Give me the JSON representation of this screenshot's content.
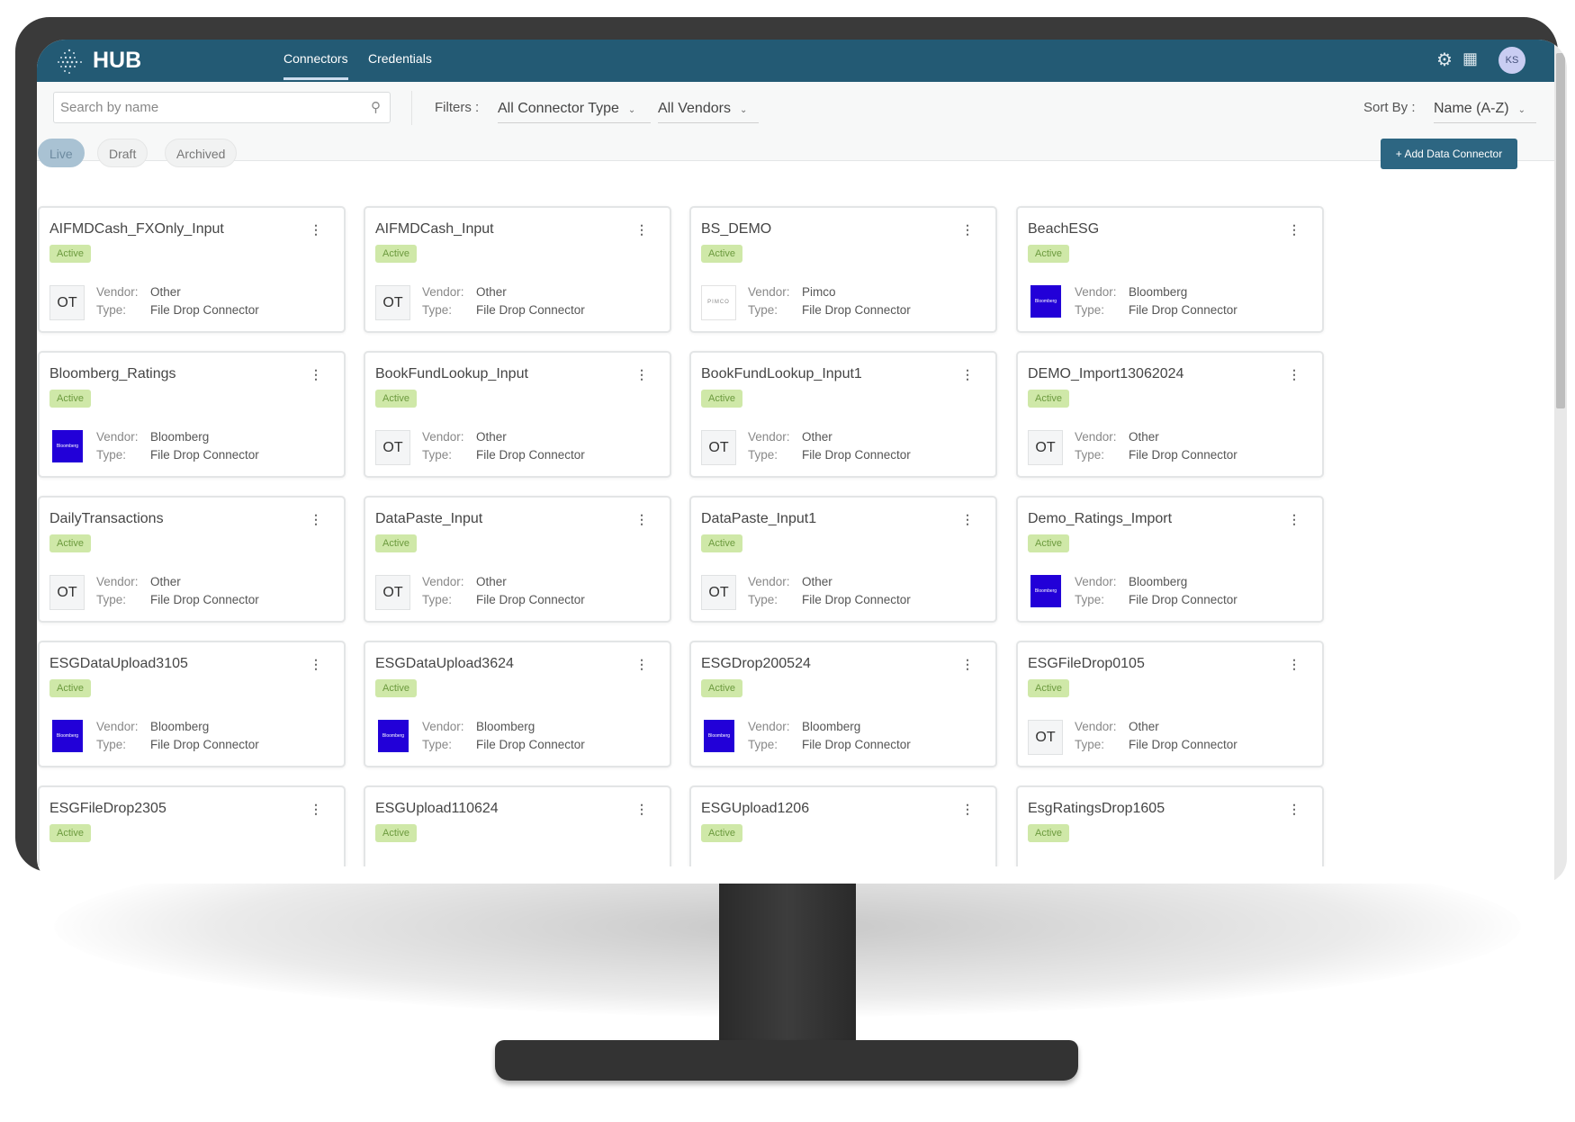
{
  "app": {
    "brand": "HUB",
    "tabs": [
      {
        "label": "Connectors",
        "active": true
      },
      {
        "label": "Credentials",
        "active": false
      }
    ],
    "avatar_initials": "KS",
    "header_color": "#235a74"
  },
  "toolbar": {
    "search_placeholder": "Search by name",
    "filters_label": "Filters :",
    "connector_type": "All Connector Type",
    "vendors": "All Vendors",
    "sort_label": "Sort By :",
    "sort_value": "Name (A-Z)"
  },
  "status_tabs": [
    {
      "label": "Live",
      "active": true
    },
    {
      "label": "Draft",
      "active": false
    },
    {
      "label": "Archived",
      "active": false
    }
  ],
  "add_button": "+ Add Data Connector",
  "labels": {
    "vendor": "Vendor:",
    "type": "Type:"
  },
  "cards": [
    {
      "name": "AIFMDCash_FXOnly_Input",
      "status": "Active",
      "vendor": "Other",
      "type": "File Drop Connector",
      "logo": "OT"
    },
    {
      "name": "AIFMDCash_Input",
      "status": "Active",
      "vendor": "Other",
      "type": "File Drop Connector",
      "logo": "OT"
    },
    {
      "name": "BS_DEMO",
      "status": "Active",
      "vendor": "Pimco",
      "type": "File Drop Connector",
      "logo": "PIMCO"
    },
    {
      "name": "BeachESG",
      "status": "Active",
      "vendor": "Bloomberg",
      "type": "File Drop Connector",
      "logo": "Bloomberg"
    },
    {
      "name": "Bloomberg_Ratings",
      "status": "Active",
      "vendor": "Bloomberg",
      "type": "File Drop Connector",
      "logo": "Bloomberg"
    },
    {
      "name": "BookFundLookup_Input",
      "status": "Active",
      "vendor": "Other",
      "type": "File Drop Connector",
      "logo": "OT"
    },
    {
      "name": "BookFundLookup_Input1",
      "status": "Active",
      "vendor": "Other",
      "type": "File Drop Connector",
      "logo": "OT"
    },
    {
      "name": "DEMO_Import13062024",
      "status": "Active",
      "vendor": "Other",
      "type": "File Drop Connector",
      "logo": "OT"
    },
    {
      "name": "DailyTransactions",
      "status": "Active",
      "vendor": "Other",
      "type": "File Drop Connector",
      "logo": "OT"
    },
    {
      "name": "DataPaste_Input",
      "status": "Active",
      "vendor": "Other",
      "type": "File Drop Connector",
      "logo": "OT"
    },
    {
      "name": "DataPaste_Input1",
      "status": "Active",
      "vendor": "Other",
      "type": "File Drop Connector",
      "logo": "OT"
    },
    {
      "name": "Demo_Ratings_Import",
      "status": "Active",
      "vendor": "Bloomberg",
      "type": "File Drop Connector",
      "logo": "Bloomberg"
    },
    {
      "name": "ESGDataUpload3105",
      "status": "Active",
      "vendor": "Bloomberg",
      "type": "File Drop Connector",
      "logo": "Bloomberg"
    },
    {
      "name": "ESGDataUpload3624",
      "status": "Active",
      "vendor": "Bloomberg",
      "type": "File Drop Connector",
      "logo": "Bloomberg"
    },
    {
      "name": "ESGDrop200524",
      "status": "Active",
      "vendor": "Bloomberg",
      "type": "File Drop Connector",
      "logo": "Bloomberg"
    },
    {
      "name": "ESGFileDrop0105",
      "status": "Active",
      "vendor": "Other",
      "type": "File Drop Connector",
      "logo": "OT"
    },
    {
      "name": "ESGFileDrop2305",
      "status": "Active"
    },
    {
      "name": "ESGUpload110624",
      "status": "Active"
    },
    {
      "name": "ESGUpload1206",
      "status": "Active"
    },
    {
      "name": "EsgRatingsDrop1605",
      "status": "Active"
    }
  ]
}
